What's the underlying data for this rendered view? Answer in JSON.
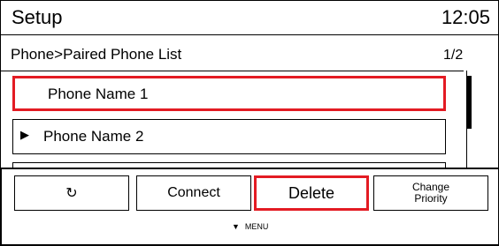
{
  "header": {
    "title": "Setup",
    "time": "12:05"
  },
  "breadcrumb": {
    "path": "Phone>Paired Phone List",
    "page": "1/2"
  },
  "list": {
    "items": [
      {
        "label": "Phone Name 1"
      },
      {
        "label": "Phone Name 2",
        "marker": "▶"
      }
    ]
  },
  "menu": {
    "buttons": {
      "back_icon": "↻",
      "connect": "Connect",
      "delete": "Delete",
      "change_priority_line1": "Change",
      "change_priority_line2": "Priority"
    },
    "hint_arrow": "▼",
    "hint_label": "MENU"
  },
  "colors": {
    "selection": "#e31b23",
    "border": "#000000",
    "background": "#ffffff"
  }
}
